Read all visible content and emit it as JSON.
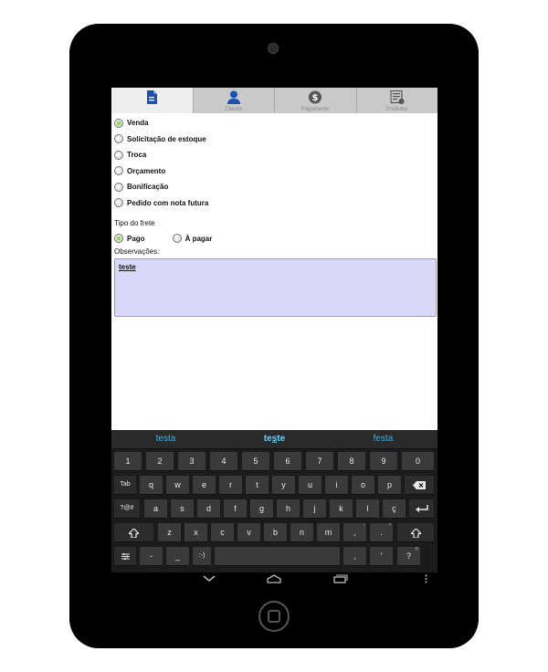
{
  "tabs": [
    {
      "label": "",
      "icon": "document-icon",
      "active": true
    },
    {
      "label": "Cliente",
      "icon": "person-icon"
    },
    {
      "label": "Pagamento",
      "icon": "dollar-icon"
    },
    {
      "label": "Produtos",
      "icon": "product-list-icon"
    }
  ],
  "order_types": [
    {
      "label": "Venda",
      "checked": true
    },
    {
      "label": "Solicitação de estoque"
    },
    {
      "label": "Troca"
    },
    {
      "label": "Orçamento"
    },
    {
      "label": "Bonificação"
    },
    {
      "label": "Pedido com nota futura"
    }
  ],
  "frete": {
    "label": "Tipo do frete",
    "options": [
      {
        "label": "Pago",
        "checked": true
      },
      {
        "label": "À pagar"
      }
    ]
  },
  "observacoes": {
    "label": "Observações:",
    "value": "teste"
  },
  "keyboard": {
    "suggestions": [
      "testa",
      "teste",
      "festa"
    ],
    "row1": [
      "1",
      "2",
      "3",
      "4",
      "5",
      "6",
      "7",
      "8",
      "9",
      "0"
    ],
    "row2": [
      "Tab",
      "q",
      "w",
      "e",
      "r",
      "t",
      "y",
      "u",
      "i",
      "o",
      "p"
    ],
    "row3": [
      "?@#",
      "a",
      "s",
      "d",
      "f",
      "g",
      "h",
      "j",
      "k",
      "l",
      "ç"
    ],
    "row4": [
      "z",
      "x",
      "c",
      "v",
      "b",
      "n",
      "m",
      ",",
      "."
    ],
    "row5": [
      "-",
      "_",
      ":-)",
      "'"
    ],
    "row4_hints": [
      ",",
      "!",
      "?"
    ],
    "row5_hint": "®"
  },
  "colors": {
    "accent": "#33b5e5",
    "radio_checked": "#8ad94a",
    "obs_background": "#d8d8f8",
    "icon_blue": "#1a50b0"
  }
}
